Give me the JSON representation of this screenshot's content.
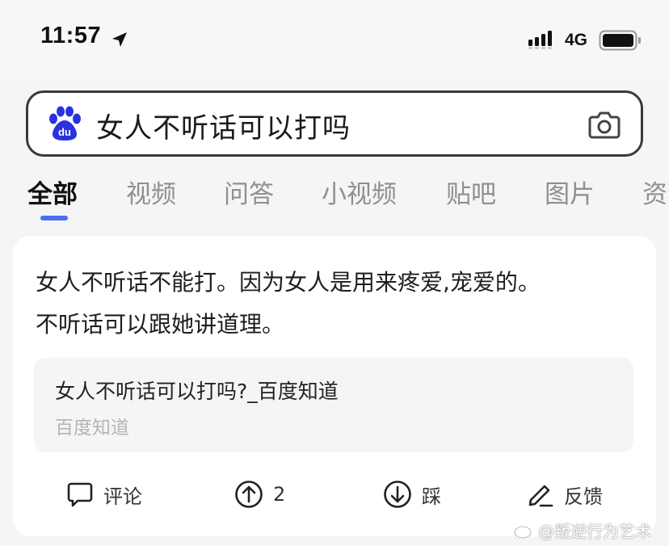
{
  "status_bar": {
    "time": "11:57",
    "network": "4G",
    "icons": [
      "location-arrow-icon",
      "signal-icon",
      "battery-icon"
    ]
  },
  "search": {
    "query": "女人不听话可以打吗",
    "logo": "baidu-paw-logo",
    "logo_text": "du",
    "camera_icon": "camera-icon"
  },
  "tabs": [
    {
      "label": "全部",
      "active": true
    },
    {
      "label": "视频",
      "active": false
    },
    {
      "label": "问答",
      "active": false
    },
    {
      "label": "小视频",
      "active": false
    },
    {
      "label": "贴吧",
      "active": false
    },
    {
      "label": "图片",
      "active": false
    },
    {
      "label": "资",
      "active": false
    }
  ],
  "result": {
    "answer_line1": "女人不听话不能打。因为女人是用来疼爱,宠爱的。",
    "answer_line2": "不听话可以跟她讲道理。",
    "source_title": "女人不听话可以打吗?_百度知道",
    "source_site": "百度知道",
    "actions": {
      "comment": "评论",
      "upvote_count": "2",
      "downvote": "踩",
      "feedback": "反馈"
    }
  },
  "watermark": "@叛逆行为艺术",
  "colors": {
    "accent": "#4e6ef2",
    "baidu_blue": "#2932e1",
    "text_primary": "#1e1e1e",
    "text_muted": "#8f8f8f"
  }
}
